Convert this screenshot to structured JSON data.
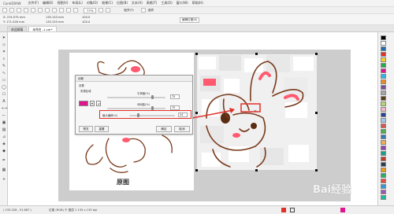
{
  "app": {
    "title": "CorelDRAW"
  },
  "menubar": {
    "items": [
      "文件(F)",
      "编辑(E)",
      "视图(V)",
      "布局(L)",
      "对象(O)",
      "效果(C)",
      "位图(B)",
      "文本(X)",
      "表格(T)",
      "工具(O)",
      "窗口(W)",
      "帮助(H)"
    ]
  },
  "toolbar": {
    "zoom": "77%",
    "snap_label": "贴齐(T)",
    "settings_label": "选项"
  },
  "propbar": {
    "x": "X: 274.075 mm",
    "y": "Y: 171.026 mm",
    "w": "135.133 mm",
    "h": "135.133 mm",
    "scale_w": "100.0",
    "scale_h": "100.0",
    "mode": "编辑位图(E)"
  },
  "tabs": [
    {
      "label": "欢迎屏幕"
    },
    {
      "label": "未命名 -1.cdr*"
    }
  ],
  "dialog": {
    "title": "创新",
    "section": "设置",
    "source_label": "来源区域",
    "smooth_label": "平滑度(%)",
    "smooth_value": "75",
    "spacing_label": "块间距(%)",
    "spacing_value": "75",
    "max_offset_label": "最大偏移(%)",
    "max_offset_value": "24",
    "preview_button": "预览",
    "reset_button": "重置",
    "ok_button": "确定",
    "cancel_button": "取消"
  },
  "canvas": {
    "caption": "原图"
  },
  "status": {
    "coords": "( 233.328 , 91.687 )",
    "info": "位图 (RGB) 于 图层 1 135 x 135 dpi"
  },
  "watermark": {
    "text": "Bai经验"
  },
  "colors": {
    "accent_red": "#e0302a",
    "rabbit_pink": "#ff5a70",
    "rabbit_brown": "#7a3b1d",
    "selected_swatch": "#e0148c"
  },
  "palette": [
    "#000000",
    "#ffffff",
    "#1a6fb0",
    "#e0302a",
    "#f7d21c",
    "#2aa84a",
    "#e0148c",
    "#26b7e8",
    "#f18a1e",
    "#7c4a9e",
    "#a6a6a6",
    "#5a3b1c",
    "#b7d66e",
    "#f7b5c8",
    "#2f3f8f",
    "#9ec9e8"
  ]
}
